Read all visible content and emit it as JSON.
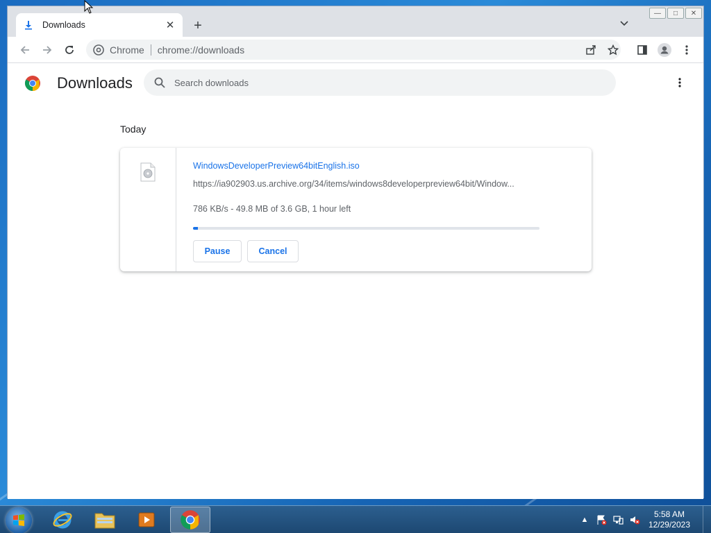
{
  "browser": {
    "tab": {
      "title": "Downloads"
    },
    "omnibox": {
      "scheme_label": "Chrome",
      "url": "chrome://downloads"
    }
  },
  "downloads_page": {
    "title": "Downloads",
    "search": {
      "placeholder": "Search downloads"
    },
    "date_group": "Today",
    "items": [
      {
        "file_name": "WindowsDeveloperPreview64bitEnglish.iso",
        "url": "https://ia902903.us.archive.org/34/items/windows8developerpreview64bit/Window...",
        "status": "786 KB/s - 49.8 MB of 3.6 GB, 1 hour left",
        "progress_percent": 1.4,
        "pause_label": "Pause",
        "cancel_label": "Cancel"
      }
    ]
  },
  "taskbar": {
    "clock": {
      "time": "5:58 AM",
      "date": "12/29/2023"
    }
  },
  "colors": {
    "accent": "#1a73e8",
    "text_primary": "#202124",
    "text_secondary": "#5f6368"
  }
}
